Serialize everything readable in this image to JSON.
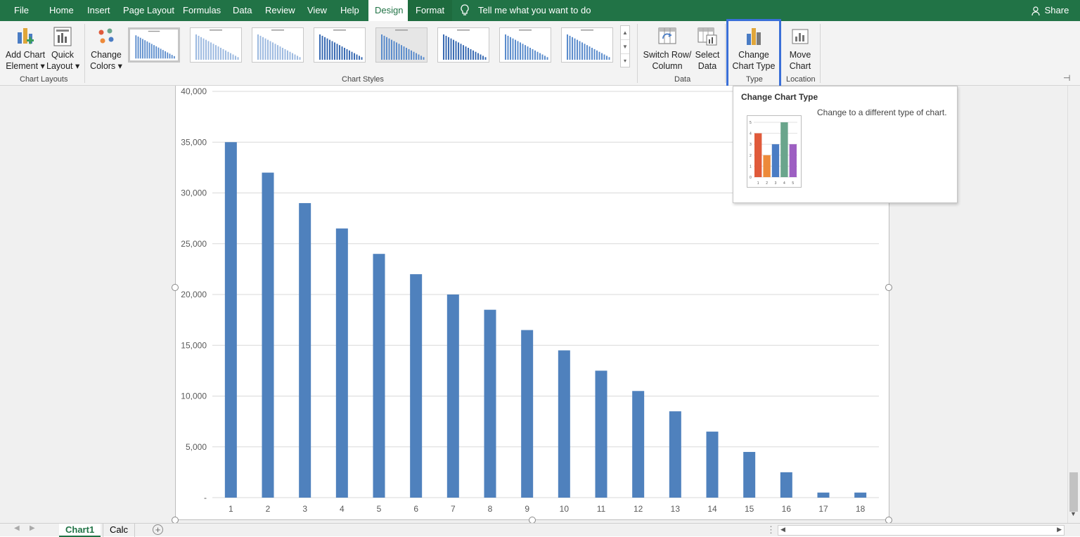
{
  "menu": {
    "items": [
      "File",
      "Home",
      "Insert",
      "Page Layout",
      "Formulas",
      "Data",
      "Review",
      "View",
      "Help",
      "Design",
      "Format"
    ],
    "active": "Design",
    "tell_me": "Tell me what you want to do",
    "share": "Share",
    "colors": {
      "brand": "#217346"
    }
  },
  "ribbon": {
    "add_chart_element": {
      "line1": "Add Chart",
      "line2": "Element"
    },
    "quick_layout": {
      "line1": "Quick",
      "line2": "Layout"
    },
    "change_colors": {
      "line1": "Change",
      "line2": "Colors"
    },
    "switch_row_column": {
      "line1": "Switch Row/",
      "line2": "Column"
    },
    "select_data": {
      "line1": "Select",
      "line2": "Data"
    },
    "change_chart_type": {
      "line1": "Change",
      "line2": "Chart Type"
    },
    "move_chart": {
      "line1": "Move",
      "line2": "Chart"
    },
    "groups": {
      "chart_layouts": "Chart Layouts",
      "chart_styles": "Chart Styles",
      "data": "Data",
      "type": "Type",
      "location": "Location"
    },
    "chart_style_count": 8
  },
  "tooltip": {
    "title": "Change Chart Type",
    "description": "Change to a different type of chart.",
    "preview_values": [
      4,
      2,
      3,
      5,
      3
    ],
    "preview_colors": [
      "#e05a3a",
      "#ed8a3a",
      "#4a7cc4",
      "#6aa58c",
      "#9d5fc2"
    ]
  },
  "chart_data": {
    "type": "bar",
    "categories": [
      "1",
      "2",
      "3",
      "4",
      "5",
      "6",
      "7",
      "8",
      "9",
      "10",
      "11",
      "12",
      "13",
      "14",
      "15",
      "16",
      "17",
      "18"
    ],
    "values": [
      35000,
      32000,
      29000,
      26500,
      24000,
      22000,
      20000,
      18500,
      16500,
      14500,
      12500,
      10500,
      8500,
      6500,
      4500,
      2500,
      500,
      500
    ],
    "ylim": [
      0,
      40000
    ],
    "yticks": [
      "-",
      "5,000",
      "10,000",
      "15,000",
      "20,000",
      "25,000",
      "30,000",
      "35,000",
      "40,000"
    ],
    "grid": true,
    "color": "#4f81bd"
  },
  "sheets": {
    "tabs": [
      "Chart1",
      "Calc"
    ],
    "active": "Chart1"
  }
}
